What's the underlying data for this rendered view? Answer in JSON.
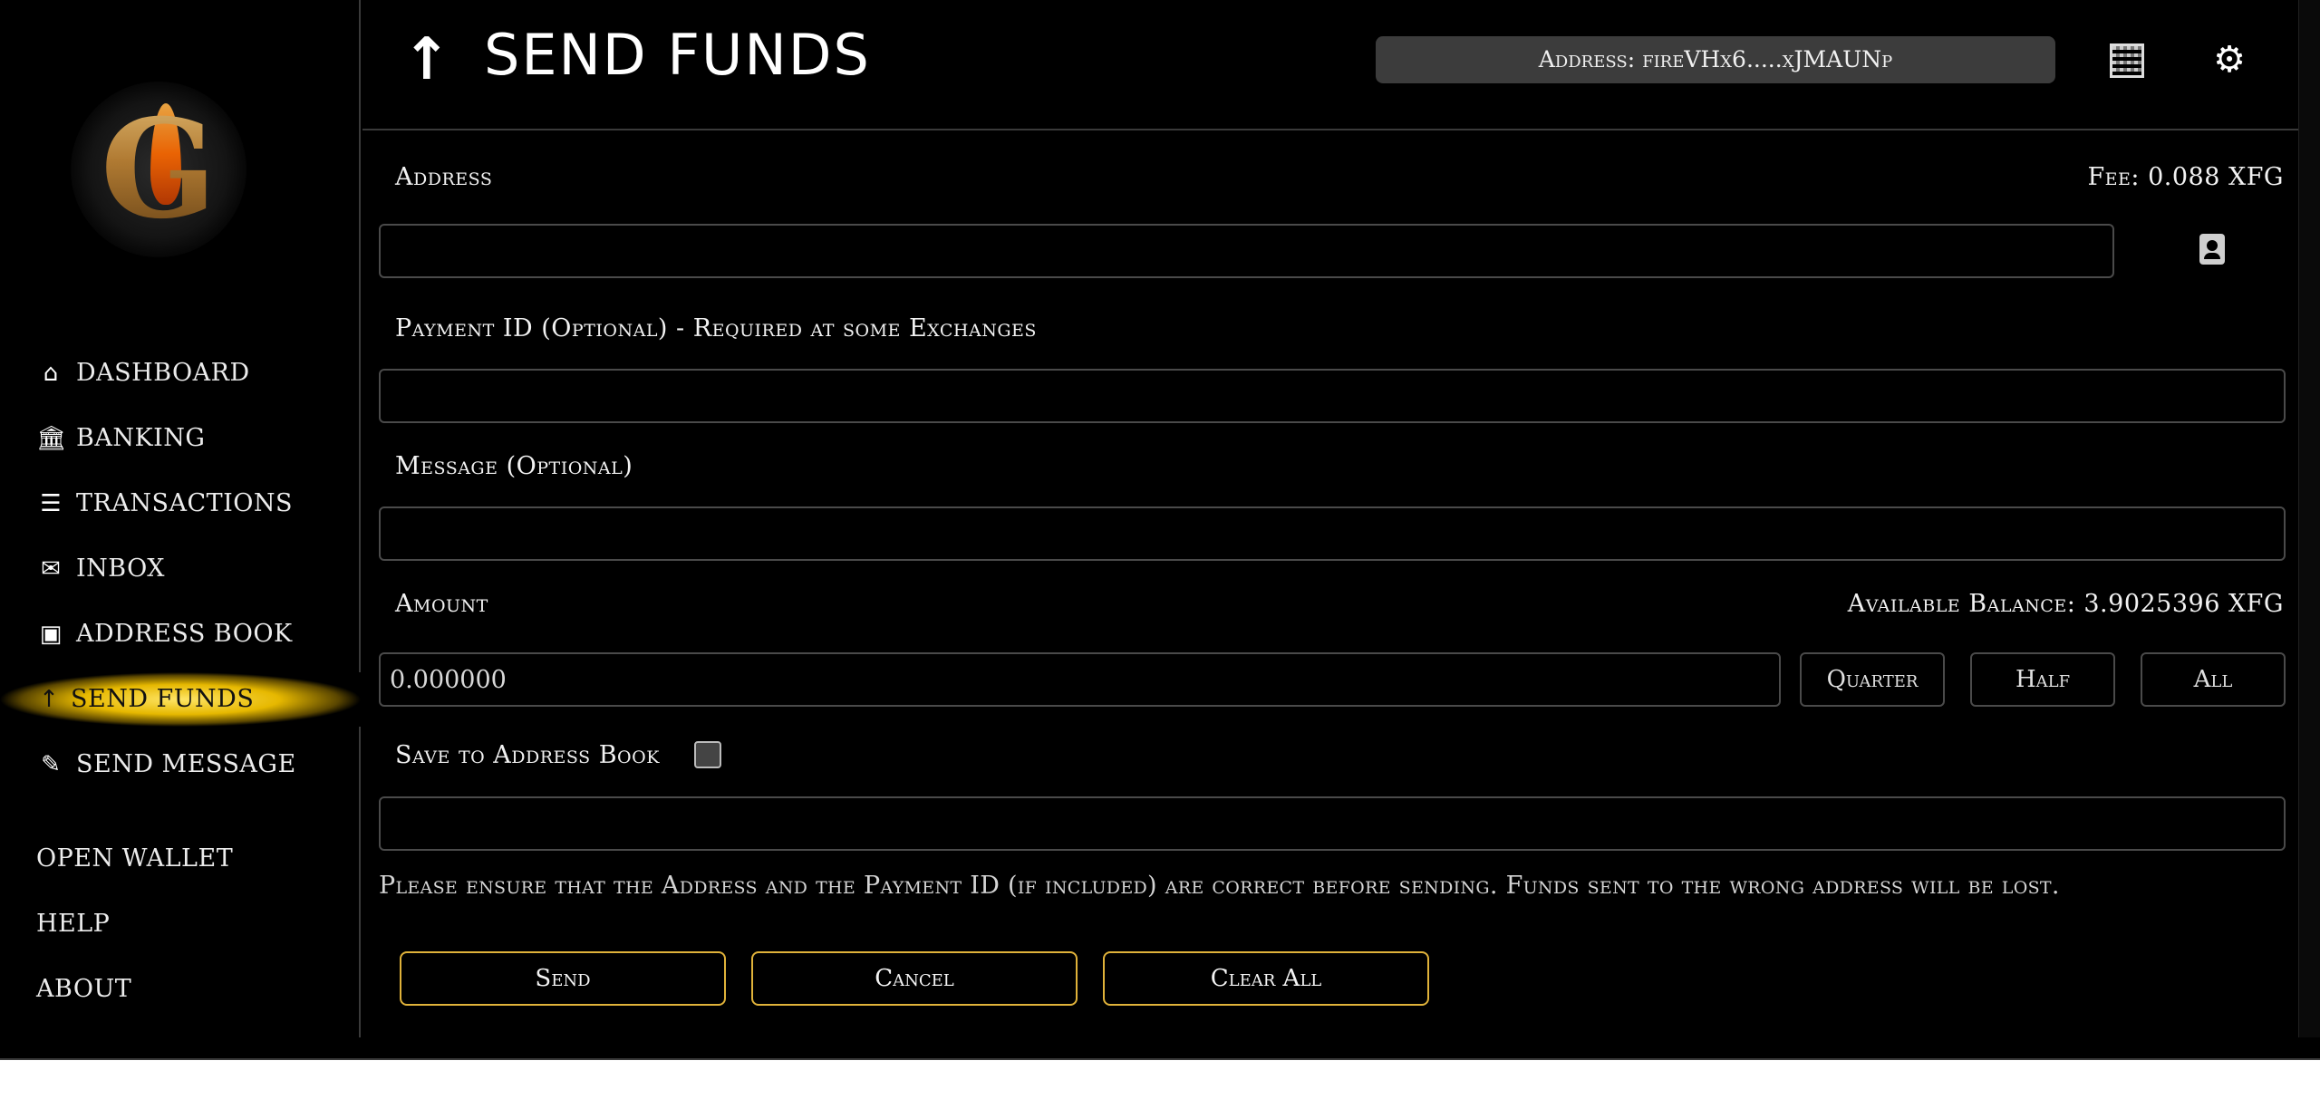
{
  "header": {
    "title": "SEND FUNDS",
    "address_label": "Address: fireVHx6.....xJMAUNp",
    "icons": {
      "title": "arrow-up-icon",
      "qr": "qr-code-icon",
      "settings": "gear-icon"
    }
  },
  "sidebar": {
    "logo_letter": "G",
    "items": [
      {
        "label": "DASHBOARD",
        "icon": "home-icon",
        "glyph": "⌂"
      },
      {
        "label": "BANKING",
        "icon": "bank-icon",
        "glyph": "🏛"
      },
      {
        "label": "TRANSACTIONS",
        "icon": "list-check-icon",
        "glyph": "☰"
      },
      {
        "label": "INBOX",
        "icon": "chat-icon",
        "glyph": "✉"
      },
      {
        "label": "ADDRESS BOOK",
        "icon": "contact-book-icon",
        "glyph": "▣"
      },
      {
        "label": "SEND FUNDS",
        "icon": "arrow-up-icon",
        "glyph": "↑",
        "active": true
      },
      {
        "label": "SEND MESSAGE",
        "icon": "message-edit-icon",
        "glyph": "✎"
      }
    ],
    "bottom_items": [
      {
        "label": "OPEN WALLET"
      },
      {
        "label": "HELP"
      },
      {
        "label": "ABOUT"
      }
    ]
  },
  "form": {
    "address_label": "Address",
    "fee_label": "Fee: 0.088 XFG",
    "address_value": "",
    "payment_id_label": "Payment ID (Optional) - Required at some Exchanges",
    "payment_id_value": "",
    "message_label": "Message (Optional)",
    "message_value": "",
    "amount_label": "Amount",
    "balance_label": "Available Balance: 3.9025396 XFG",
    "amount_value": "0.000000",
    "quarter_label": "Quarter",
    "half_label": "Half",
    "all_label": "All",
    "save_label": "Save to Address Book",
    "save_checked": false,
    "save_name_value": "",
    "warning": "Please ensure that the Address and the Payment ID (if included) are correct before sending. Funds sent to the wrong address will be lost."
  },
  "actions": {
    "send_label": "Send",
    "cancel_label": "Cancel",
    "clear_label": "Clear All"
  },
  "colors": {
    "background": "#000000",
    "accent_gold": "#e0b23a",
    "active_highlight": "#ffe566",
    "pill": "#3c3c3c"
  }
}
